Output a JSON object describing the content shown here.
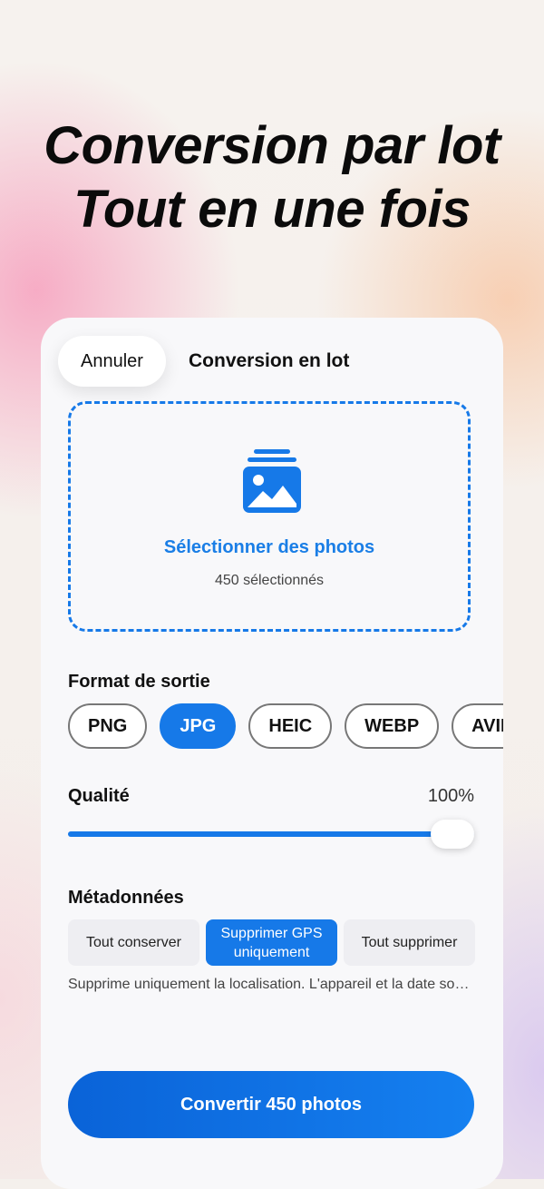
{
  "hero": {
    "line1": "Conversion par lot",
    "line2": "Tout en une fois"
  },
  "header": {
    "cancel_label": "Annuler",
    "title": "Conversion en lot"
  },
  "dropzone": {
    "icon": "photo-stack-icon",
    "label": "Sélectionner des photos",
    "count": "450 sélectionnés"
  },
  "format": {
    "label": "Format de sortie",
    "options": [
      "PNG",
      "JPG",
      "HEIC",
      "WEBP",
      "AVIF"
    ],
    "selected": "JPG"
  },
  "quality": {
    "label": "Qualité",
    "value_text": "100%",
    "value": 100
  },
  "metadata": {
    "label": "Métadonnées",
    "options": [
      "Tout conserver",
      "Supprimer GPS uniquement",
      "Tout supprimer"
    ],
    "selected": "Supprimer GPS uniquement",
    "description": "Supprime uniquement la localisation. L'appareil et la date sont conservés."
  },
  "convert_label": "Convertir 450 photos",
  "colors": {
    "accent": "#1679e8",
    "card": "#f8f8fa",
    "text": "#111111"
  }
}
